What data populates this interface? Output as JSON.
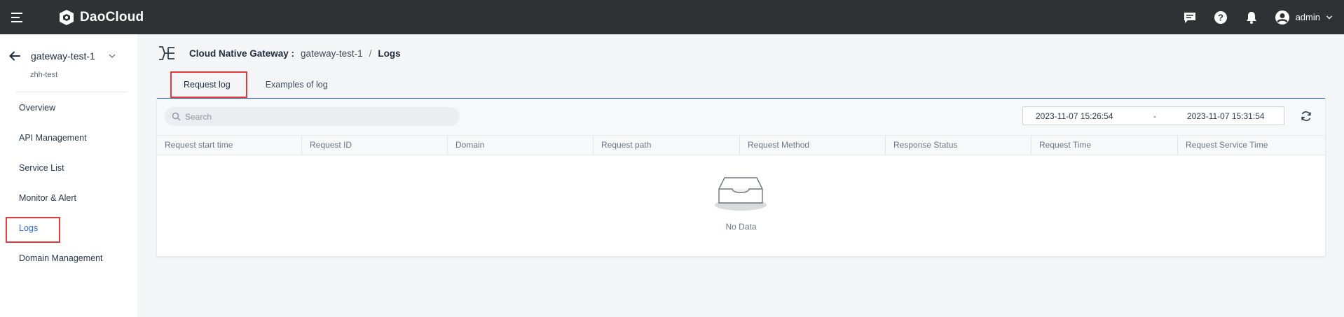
{
  "app": {
    "brand": "DaoCloud",
    "user": "admin"
  },
  "sidebar": {
    "title": "gateway-test-1",
    "subtitle": "zhh-test",
    "items": [
      {
        "label": "Overview"
      },
      {
        "label": "API Management"
      },
      {
        "label": "Service List"
      },
      {
        "label": "Monitor & Alert"
      },
      {
        "label": "Logs"
      },
      {
        "label": "Domain Management"
      }
    ],
    "active_index": 4
  },
  "breadcrumb": {
    "root": "Cloud Native Gateway :",
    "middle": "gateway-test-1",
    "separator": "/",
    "current": "Logs"
  },
  "tabs": [
    {
      "label": "Request log",
      "active": true
    },
    {
      "label": "Examples of log",
      "active": false
    }
  ],
  "toolbar": {
    "search_placeholder": "Search",
    "date_start": "2023-11-07 15:26:54",
    "date_separator": "-",
    "date_end": "2023-11-07 15:31:54"
  },
  "table": {
    "columns": [
      "Request start time",
      "Request ID",
      "Domain",
      "Request path",
      "Request Method",
      "Response Status",
      "Request Time",
      "Request Service Time"
    ],
    "rows": [],
    "empty_text": "No Data"
  },
  "colors": {
    "topbar": "#2f3134",
    "accent": "#2f6fd6",
    "highlight_box": "#e23b3b"
  },
  "icons": [
    "menu-icon",
    "logo-icon",
    "message-icon",
    "help-icon",
    "bell-icon",
    "user-avatar-icon",
    "chevron-down-icon",
    "back-arrow-icon",
    "gateway-icon",
    "search-icon",
    "refresh-icon",
    "empty-inbox-icon"
  ]
}
